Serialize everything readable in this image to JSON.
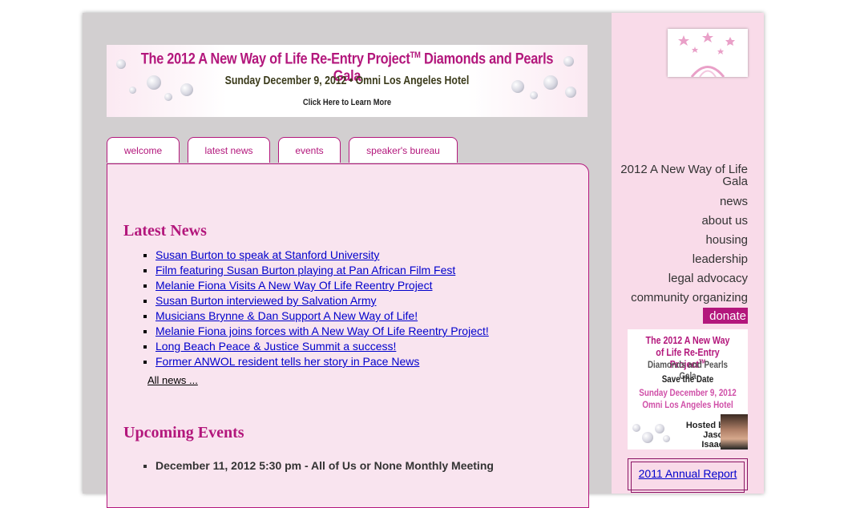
{
  "banner": {
    "title": "The 2012 A New Way of Life Re-Entry Project",
    "title_tm": "TM",
    "title_tail": " Diamonds and Pearls Gala",
    "subtitle": "Sunday December 9, 2012  •  Omni Los Angeles Hotel",
    "cta": "Click Here to Learn More"
  },
  "tabs": [
    "welcome",
    "latest news",
    "events",
    "speaker's bureau"
  ],
  "latest_news": {
    "heading": "Latest News",
    "items": [
      "Susan Burton to speak at Stanford University",
      "Film featuring Susan Burton playing at Pan African Film Fest",
      "Melanie Fiona Visits A New Way Of Life Reentry Project",
      "Susan Burton interviewed by Salvation Army",
      "Musicians Brynne & Dan Support A New Way of Life!",
      "Melanie Fiona joins forces with A New Way Of Life Reentry Project!",
      "Long Beach Peace & Justice Summit a success!",
      "Former ANWOL resident tells her story in Pace News"
    ],
    "all_link": "All news ..."
  },
  "upcoming_events": {
    "heading": "Upcoming Events",
    "items": [
      "December 11, 2012 5:30 pm - All of Us or None Monthly Meeting"
    ]
  },
  "sidebar": {
    "nav": [
      "2012 A New Way of Life Gala",
      "news",
      "about us",
      "housing",
      "leadership",
      "legal advocacy",
      "community organizing"
    ],
    "donate": "donate",
    "gala_ad": {
      "line1": "The 2012 A New Way",
      "line2": "of Life Re-Entry Project",
      "line2_tm": "TM",
      "line3": "Diamonds and Pearls Gala",
      "line4": "Save the Date",
      "line5": "Sunday December 9, 2012",
      "line6": "Omni Los Angeles Hotel",
      "line7": "Hosted by",
      "line8": "Jason Isaacs"
    },
    "annual_report": "2011 Annual Report"
  },
  "colors": {
    "accent": "#b3177c",
    "main_bg": "#d2cfd0",
    "sidebar_bg": "#f9dbe9",
    "content_bg": "#f9e4ef",
    "link": "#0000cc"
  }
}
